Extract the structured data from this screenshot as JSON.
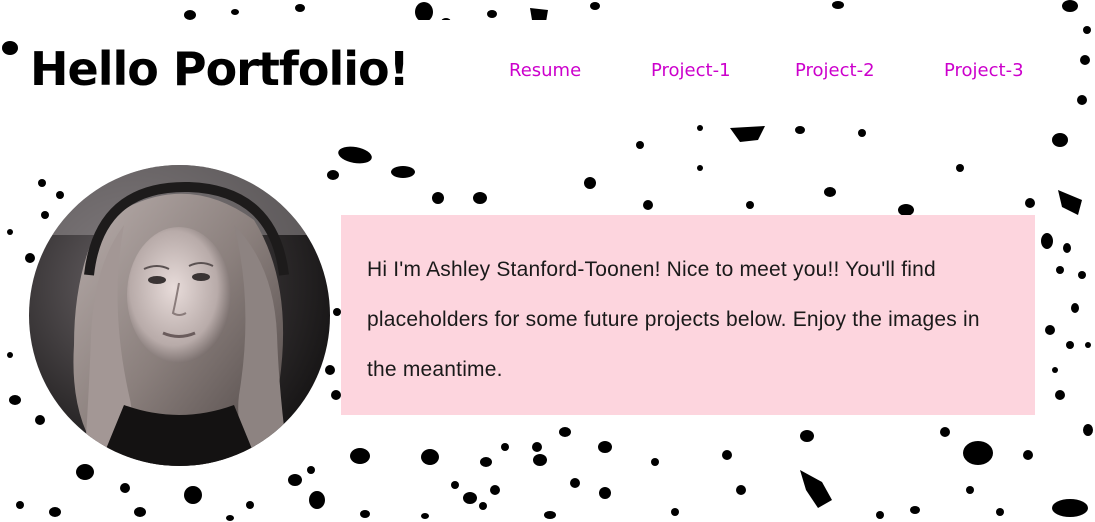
{
  "header": {
    "title": "Hello Portfolio!",
    "nav": [
      {
        "label": "Resume"
      },
      {
        "label": "Project-1"
      },
      {
        "label": "Project-2"
      },
      {
        "label": "Project-3"
      }
    ]
  },
  "profile": {
    "bio": "Hi I'm Ashley Stanford-Toonen! Nice to meet you!! You'll find placeholders for some future projects below. Enjoy the images in the meantime."
  },
  "colors": {
    "nav_link": "#cc00cc",
    "bio_background": "#fdd5de",
    "dots": "#000000"
  }
}
